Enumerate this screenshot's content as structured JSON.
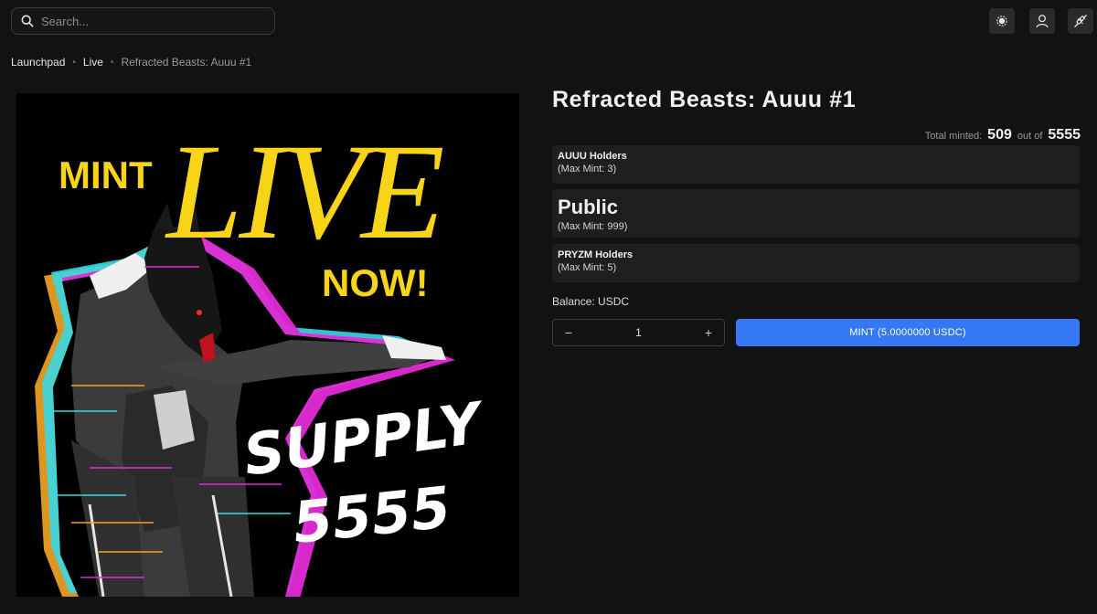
{
  "header": {
    "search_placeholder": "Search...",
    "icons": [
      "search-icon",
      "settings-icon",
      "user-icon",
      "connect-wallet-icon"
    ]
  },
  "breadcrumb": {
    "items": [
      "Launchpad",
      "Live",
      "Refracted Beasts: Auuu #1"
    ]
  },
  "hero": {
    "line1": "MINT",
    "line2": "LIVE",
    "line3": "NOW!",
    "line4": "SUPPLY",
    "line5": "5555"
  },
  "collection": {
    "title": "Refracted Beasts: Auuu #1",
    "minted_label": "Total minted:",
    "minted_count": "509",
    "out_of_label": "out of",
    "total_supply": "5555"
  },
  "tiers": [
    {
      "name": "AUUU Holders",
      "max": "(Max Mint: 3)"
    },
    {
      "name": "Public",
      "max": "(Max Mint: 999)"
    },
    {
      "name": "PRYZM Holders",
      "max": "(Max Mint: 5)"
    }
  ],
  "balance_label": "Balance: USDC",
  "stepper": {
    "minus": "−",
    "value": "1",
    "plus": "+"
  },
  "mint_button": "MINT (5.0000000 USDC)",
  "colors": {
    "accent": "#3578f6",
    "hero_yellow": "#f7d417",
    "glitch_magenta": "#e22ad6",
    "glitch_cyan": "#39d7e6",
    "glitch_orange": "#f5a623"
  }
}
